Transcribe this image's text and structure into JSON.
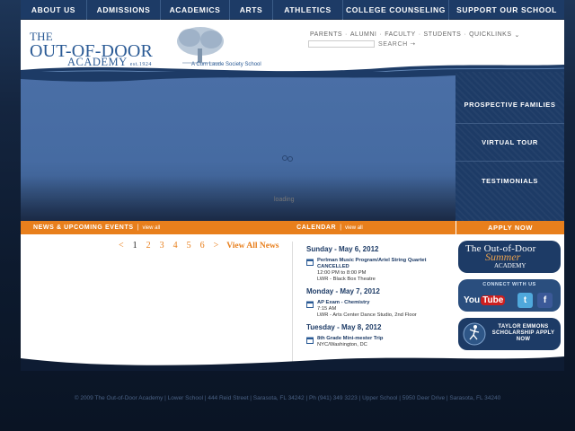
{
  "topnav": {
    "items": [
      {
        "label": "ABOUT US"
      },
      {
        "label": "ADMISSIONS"
      },
      {
        "label": "ACADEMICS"
      },
      {
        "label": "ARTS"
      },
      {
        "label": "ATHLETICS"
      },
      {
        "label": "COLLEGE COUNSELING"
      },
      {
        "label": "SUPPORT OUR SCHOOL"
      }
    ]
  },
  "header": {
    "logo_the": "THE",
    "logo_main": "OUT-OF-DOOR",
    "logo_academy": "ACADEMY",
    "logo_est": "est.1924",
    "tagline": "A Cum Laude Society School",
    "util_links": [
      "PARENTS",
      "ALUMNI",
      "FACULTY",
      "STUDENTS",
      "QUICKLINKS"
    ],
    "search_label": "SEARCH",
    "search_placeholder": ""
  },
  "hero": {
    "loading": "loading"
  },
  "side_menu": {
    "items": [
      {
        "label": "PROSPECTIVE FAMILIES"
      },
      {
        "label": "VIRTUAL TOUR"
      },
      {
        "label": "TESTIMONIALS"
      }
    ]
  },
  "bar": {
    "news_title": "NEWS & UPCOMING EVENTS",
    "news_link": "view all",
    "cal_title": "CALENDAR",
    "cal_link": "view all",
    "apply": "APPLY NOW"
  },
  "news_pager": {
    "prev": "<",
    "pages": [
      "1",
      "2",
      "3",
      "4",
      "5",
      "6"
    ],
    "next": ">",
    "view_all": "View All News"
  },
  "calendar": {
    "days": [
      {
        "date": "Sunday - May 6, 2012",
        "events": [
          {
            "title": "Perlman Music Program/Ariel String Quartet CANCELLED",
            "time": "12:00 PM to 8:00 PM",
            "location": "LWR - Black Box Theatre"
          }
        ]
      },
      {
        "date": "Monday - May 7, 2012",
        "events": [
          {
            "title": "AP Exam - Chemistry",
            "time": "7:15 AM",
            "location": "LWR - Arts Center Dance Studio, 2nd Floor"
          }
        ]
      },
      {
        "date": "Tuesday - May 8, 2012",
        "events": [
          {
            "title": "8th Grade Mini-mester Trip",
            "time": "",
            "location": "NYC/Washington, DC"
          }
        ]
      }
    ]
  },
  "widgets": {
    "summer_title": "The Out-of-Door",
    "summer_script": "Summer",
    "summer_academy": "ACADEMY",
    "connect": "CONNECT WITH US",
    "youtube_you": "You",
    "youtube_tube": "Tube",
    "twitter": "t",
    "facebook": "f",
    "scholarship": "TAYLOR EMMONS SCHOLARSHIP APPLY NOW"
  },
  "footer": {
    "text": "© 2009 The Out-of-Door Academy  |  Lower School  |  444 Reid Street  |  Sarasota, FL 34242  |  Ph (941) 349 3223  |  Upper School  |  5950 Deer Drive  |  Sarasota, FL 34240"
  }
}
